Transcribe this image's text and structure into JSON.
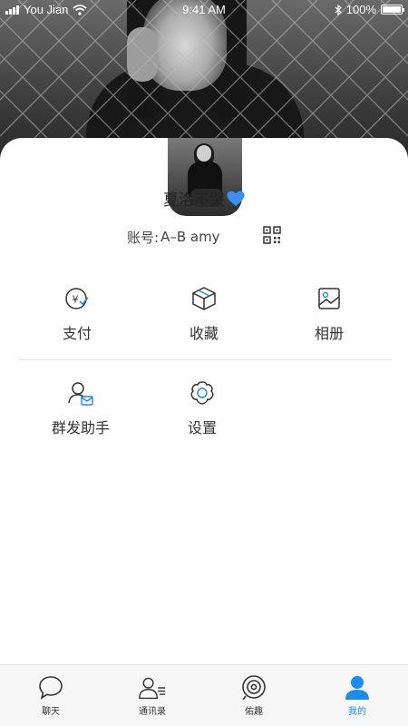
{
  "status_bar": {
    "carrier": "You Jian",
    "time": "9:41 AM",
    "battery": "100%"
  },
  "profile": {
    "nickname": "夏洛不哭",
    "account_label": "账号:",
    "account_value": "A–B amy"
  },
  "features": [
    {
      "label": "支付",
      "icon": "payment-icon"
    },
    {
      "label": "收藏",
      "icon": "favorites-icon"
    },
    {
      "label": "相册",
      "icon": "album-icon"
    },
    {
      "label": "群发助手",
      "icon": "broadcast-assistant-icon"
    },
    {
      "label": "设置",
      "icon": "settings-icon"
    }
  ],
  "tabs": [
    {
      "label": "聊天",
      "icon": "chat-icon",
      "active": false
    },
    {
      "label": "通讯录",
      "icon": "contacts-icon",
      "active": false
    },
    {
      "label": "佑趣",
      "icon": "discover-icon",
      "active": false
    },
    {
      "label": "我的",
      "icon": "me-icon",
      "active": true
    }
  ],
  "colors": {
    "accent": "#1a8cf0",
    "heart": "#3a8ff0",
    "text": "#333333"
  }
}
